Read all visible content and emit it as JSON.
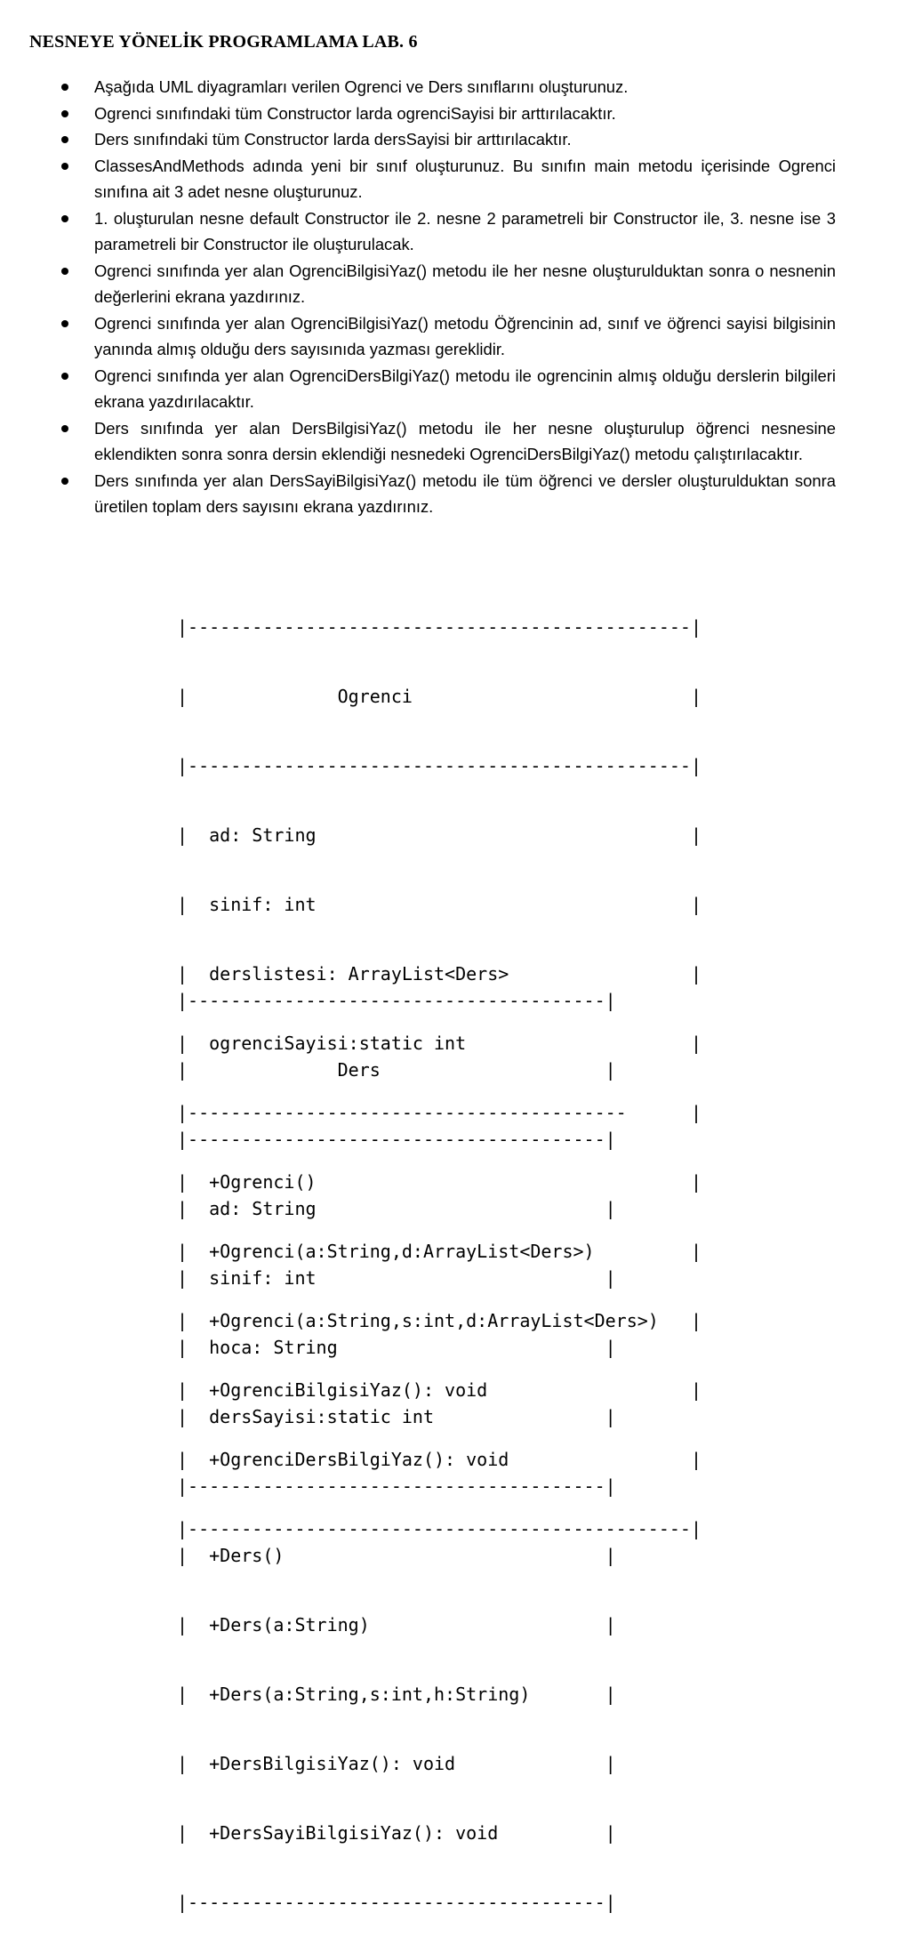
{
  "title": "NESNEYE YÖNELİK PROGRAMLAMA LAB. 6",
  "bullets": [
    "Aşağıda UML diyagramları verilen Ogrenci ve Ders sınıflarını oluşturunuz.",
    "Ogrenci sınıfındaki tüm Constructor larda ogrenciSayisi bir arttırılacaktır.",
    "Ders sınıfındaki tüm Constructor larda dersSayisi bir arttırılacaktır.",
    "ClassesAndMethods adında yeni bir sınıf oluşturunuz. Bu sınıfın main metodu içerisinde Ogrenci sınıfına ait 3 adet nesne oluşturunuz.",
    "1. oluşturulan nesne default Constructor ile 2. nesne 2 parametreli bir Constructor ile, 3. nesne ise 3 parametreli bir Constructor ile oluşturulacak.",
    "Ogrenci sınıfında yer alan OgrenciBilgisiYaz() metodu ile her nesne oluşturulduktan sonra o nesnenin değerlerini ekrana yazdırınız.",
    "Ogrenci sınıfında yer alan OgrenciBilgisiYaz() metodu Öğrencinin ad, sınıf ve öğrenci sayisi bilgisinin yanında almış olduğu ders sayısınıda yazması gereklidir.",
    "Ogrenci sınıfında yer alan OgrenciDersBilgiYaz() metodu ile ogrencinin almış olduğu derslerin bilgileri ekrana yazdırılacaktır.",
    "Ders sınıfında yer alan DersBilgisiYaz() metodu ile her nesne oluşturulup öğrenci nesnesine eklendikten sonra sonra dersin eklendiği nesnedeki OgrenciDersBilgiYaz() metodu çalıştırılacaktır.",
    "Ders sınıfında yer alan DersSayiBilgisiYaz() metodu ile tüm öğrenci ve dersler oluşturulduktan sonra üretilen toplam ders sayısını ekrana yazdırınız."
  ],
  "uml_ogrenci": [
    "|-----------------------------------------------|",
    "|              Ogrenci                          |",
    "|-----------------------------------------------|",
    "|  ad: String                                   |",
    "|  sinif: int                                   |",
    "|  derslistesi: ArrayList<Ders>                 |",
    "|  ogrenciSayisi:static int                     |",
    "|-----------------------------------------      |",
    "|  +Ogrenci()                                   |",
    "|  +Ogrenci(a:String,d:ArrayList<Ders>)         |",
    "|  +Ogrenci(a:String,s:int,d:ArrayList<Ders>)   |",
    "|  +OgrenciBilgisiYaz(): void                   |",
    "|  +OgrenciDersBilgiYaz(): void                 |",
    "|-----------------------------------------------|"
  ],
  "uml_ders": [
    "|---------------------------------------|",
    "|              Ders                     |",
    "|---------------------------------------|",
    "|  ad: String                           |",
    "|  sinif: int                           |",
    "|  hoca: String                         |",
    "|  dersSayisi:static int                |",
    "|---------------------------------------|",
    "|  +Ders()                              |",
    "|  +Ders(a:String)                      |",
    "|  +Ders(a:String,s:int,h:String)       |",
    "|  +DersBilgisiYaz(): void              |",
    "|  +DersSayiBilgisiYaz(): void          |",
    "|---------------------------------------|"
  ]
}
